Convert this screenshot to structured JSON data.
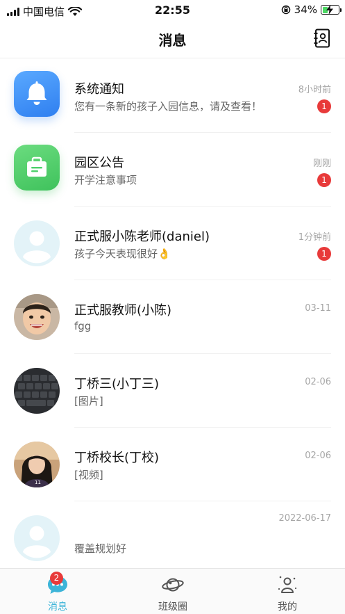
{
  "status_bar": {
    "carrier": "中国电信",
    "time": "22:55",
    "battery": "34%"
  },
  "header": {
    "title": "消息",
    "contacts_icon": "contacts-book-icon"
  },
  "messages": [
    {
      "name": "系统通知",
      "preview": "您有一条新的孩子入园信息，请及查看！",
      "time": "8小时前",
      "badge": "1",
      "avatar": "bell-icon"
    },
    {
      "name": "园区公告",
      "preview": "开学注意事项",
      "time": "刚刚",
      "badge": "1",
      "avatar": "briefcase-icon"
    },
    {
      "name": "正式服小陈老师(daniel)",
      "preview": "孩子今天表现很好👌",
      "time": "1分钟前",
      "badge": "1",
      "avatar": "default-person-icon"
    },
    {
      "name": "正式服教师(小陈)",
      "preview": "fgg",
      "time": "03-11",
      "avatar": "child-photo"
    },
    {
      "name": "丁桥三(小丁三)",
      "preview": "[图片]",
      "time": "02-06",
      "avatar": "keyboard-photo"
    },
    {
      "name": "丁桥校长(丁校)",
      "preview": "[视频]",
      "time": "02-06",
      "avatar": "girl-photo"
    },
    {
      "name": "",
      "preview": "覆盖规划好",
      "time": "2022-06-17",
      "avatar": "default-person-icon"
    }
  ],
  "tabs": [
    {
      "label": "消息",
      "icon": "chat-bubble-icon",
      "badge": "2",
      "active": true
    },
    {
      "label": "班级圈",
      "icon": "planet-icon",
      "active": false
    },
    {
      "label": "我的",
      "icon": "person-icon",
      "active": false
    }
  ],
  "colors": {
    "accent": "#3cb4d8",
    "badge": "#e83a3a",
    "system_blue": "#3a8ff5",
    "notice_green": "#4cd06a"
  }
}
